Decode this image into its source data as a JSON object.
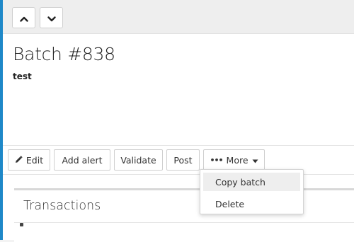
{
  "batch": {
    "title": "Batch #838",
    "subtitle": "test"
  },
  "nav": {
    "up_icon": "chevron-up-icon",
    "down_icon": "chevron-down-icon"
  },
  "toolbar": {
    "edit_label": "Edit",
    "add_alert_label": "Add alert",
    "validate_label": "Validate",
    "post_label": "Post",
    "more_label": "More"
  },
  "more_menu": {
    "items": [
      {
        "label": "Copy batch",
        "highlighted": true
      },
      {
        "label": "Delete",
        "highlighted": false
      }
    ]
  },
  "section": {
    "title": "Transactions"
  },
  "colors": {
    "accent": "#1e88c8"
  }
}
